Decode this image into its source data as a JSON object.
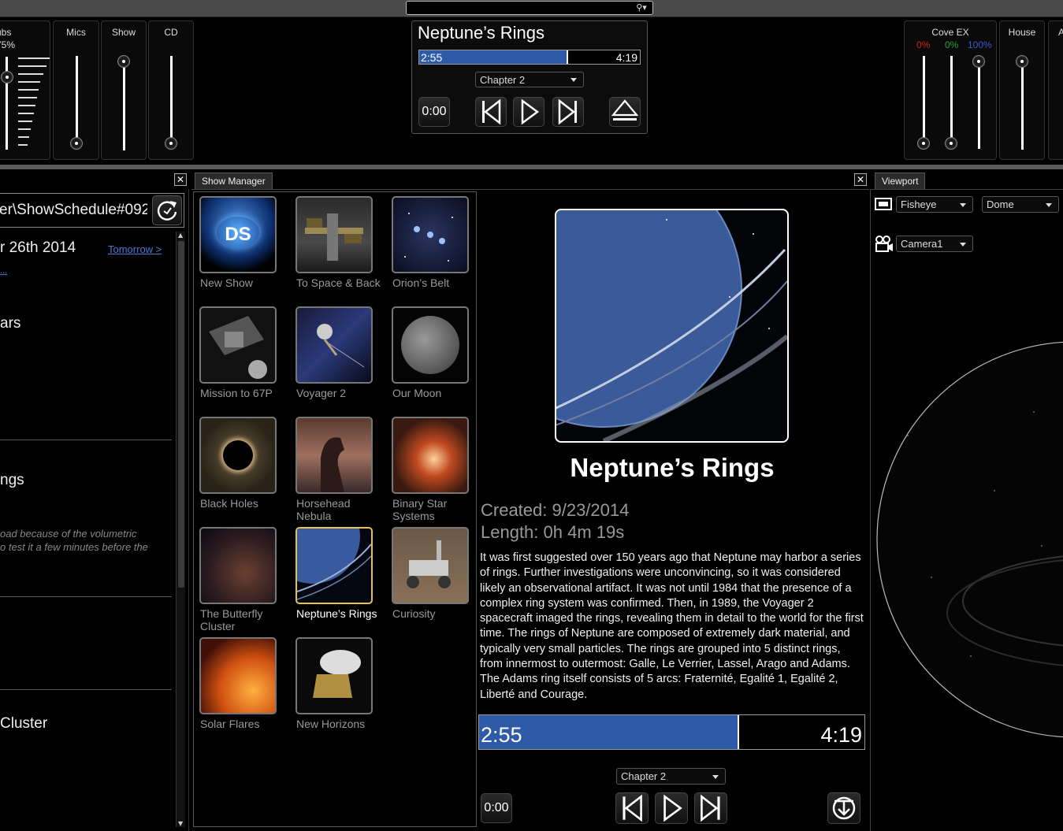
{
  "search": {
    "placeholder": "",
    "icon": "search-icon"
  },
  "mixer": {
    "left_strips": [
      {
        "label": "ubs",
        "sublabel": "75%"
      },
      {
        "label": "Mics"
      },
      {
        "label": "Show"
      },
      {
        "label": "CD"
      }
    ],
    "cove": {
      "label": "Cove EX",
      "r": "0%",
      "g": "0%",
      "b": "100%",
      "colors": {
        "r": "#d02020",
        "g": "#20a040",
        "b": "#3a5ad0"
      }
    },
    "house": {
      "label": "House"
    },
    "edge_label": "A"
  },
  "player_top": {
    "title": "Neptune’s Rings",
    "elapsed": "2:55",
    "total": "4:19",
    "progress": 0.675,
    "chapter": "Chapter 2",
    "time_button": "0:00"
  },
  "left_panel": {
    "path": "er\\ShowSchedule#092",
    "date": "r 26th 2014",
    "tomorrow": "Tomorrow >",
    "ellipsis": "...",
    "items": [
      "ars",
      "ngs",
      "Cluster"
    ],
    "note_line1": "oad because of the volumetric",
    "note_line2": "o test it a few minutes before the"
  },
  "show_manager": {
    "tab": "Show Manager",
    "shows": [
      {
        "name": "New Show"
      },
      {
        "name": "To Space & Back"
      },
      {
        "name": "Orion’s Belt"
      },
      {
        "name": "Mission to 67P"
      },
      {
        "name": "Voyager 2"
      },
      {
        "name": "Our Moon"
      },
      {
        "name": "Black Holes"
      },
      {
        "name": "Horsehead Nebula"
      },
      {
        "name": "Binary Star Systems"
      },
      {
        "name": "The Butterfly Cluster"
      },
      {
        "name": "Neptune’s Rings"
      },
      {
        "name": "Curiosity"
      },
      {
        "name": "Solar Flares"
      },
      {
        "name": "New Horizons"
      }
    ],
    "new_show_badge": "DS"
  },
  "details": {
    "title": "Neptune’s Rings",
    "created": "Created: 9/23/2014",
    "length": "Length: 0h 4m 19s",
    "description": "It was first suggested over 150 years ago that Neptune may harbor a series of rings. Further investigations were unconvincing, so it was considered likely an observational artifact. It was not until 1984 that the presence of a complex ring system was confirmed. Then, in 1989, the Voyager 2 spacecraft imaged the rings, revealing them in detail to the world for the first time. The rings of Neptune are composed of extremely dark material, and typically very small particles. The rings are grouped into 5 distinct rings, from innermost to outermost: Galle, Le Verrier, Lassel, Arago and Adams. The Adams ring itself consists of 5 arcs: Fraternité, Egalité 1, Egalité 2, Liberté and Courage.",
    "elapsed": "2:55",
    "total": "4:19",
    "progress": 0.675,
    "chapter": "Chapter 2",
    "time_button": "0:00"
  },
  "viewport": {
    "tab": "Viewport",
    "projection": "Fisheye",
    "surface": "Dome",
    "camera": "Camera1"
  },
  "colors": {
    "accent": "#2e5aa8",
    "selection": "#e6c34a"
  }
}
